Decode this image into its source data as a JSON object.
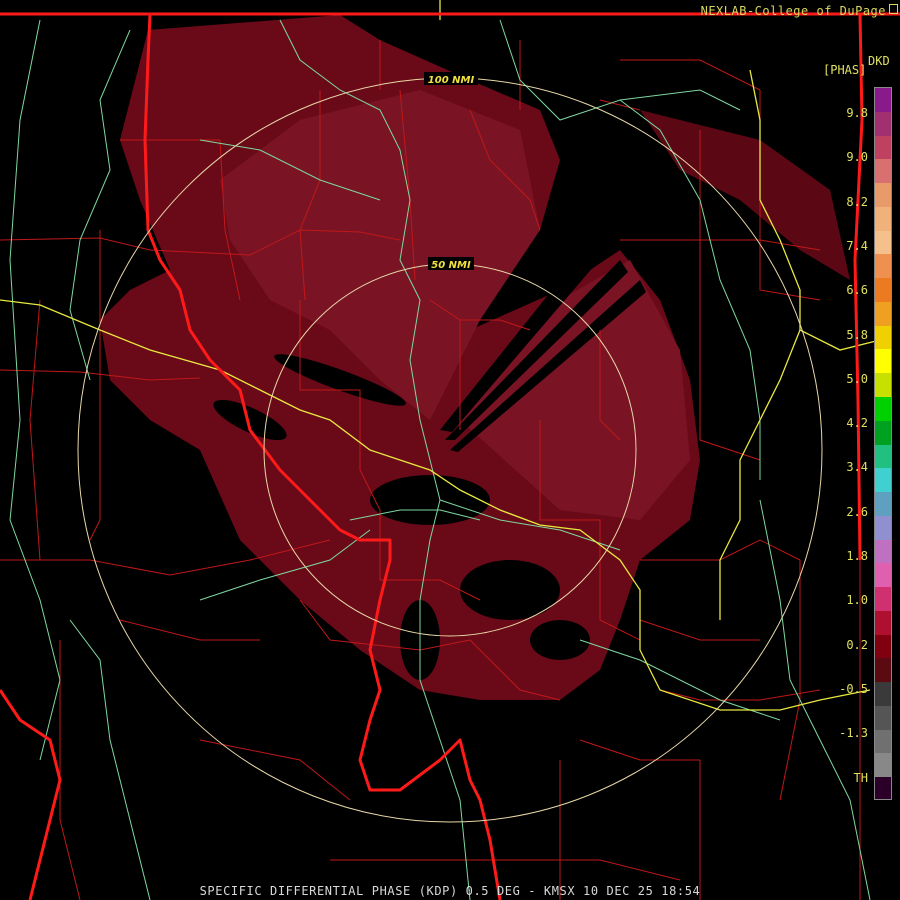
{
  "header": {
    "credit": "NEXLAB-College of DuPage"
  },
  "product": {
    "code": "DKD",
    "unit": "[PHAS]"
  },
  "range_rings": [
    {
      "label": "100 NMI"
    },
    {
      "label": "50 NMI"
    }
  ],
  "legend": {
    "ticks": [
      "9.8",
      "9.0",
      "8.2",
      "7.4",
      "6.6",
      "5.8",
      "5.0",
      "4.2",
      "3.4",
      "2.6",
      "1.8",
      "1.0",
      "0.2",
      "-0.5",
      "-1.3",
      "TH"
    ],
    "colors": [
      "#8a1a8a",
      "#a03070",
      "#c04060",
      "#d87070",
      "#e89a6a",
      "#f0b27a",
      "#f4c08c",
      "#f09050",
      "#ec7a20",
      "#f0a020",
      "#f0d000",
      "#ffff00",
      "#c8e000",
      "#00d000",
      "#00a020",
      "#20c080",
      "#40d0d0",
      "#5fa0c0",
      "#9090d0",
      "#c070c0",
      "#e060b0",
      "#d03070",
      "#b01030",
      "#800010",
      "#5a0a10",
      "#3a3a3a",
      "#555555",
      "#707070",
      "#888888",
      "#2a0028"
    ],
    "colors_note": "top-to-bottom",
    "tick_colors": "#e0e060"
  },
  "footer": {
    "caption": "SPECIFIC DIFFERENTIAL PHASE (KDP) 0.5 DEG - KMSX 10 DEC 25 18:54"
  },
  "colors": {
    "echo": "#6a0a18",
    "echo_light": "#7a1424",
    "state_border": "#ff1a1a",
    "county_border": "#c01818",
    "river": "#7ed8a0",
    "highway": "#e8e840",
    "ring": "#e8d8a8"
  }
}
